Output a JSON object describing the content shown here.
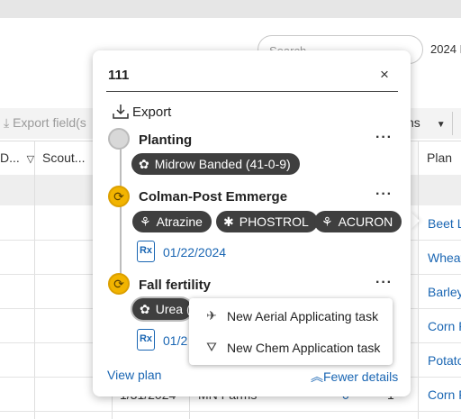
{
  "background": {
    "search_placeholder": "Search",
    "year_text": "2024 I",
    "export_fields_label": "Export field(s",
    "columns_button_label": "ns",
    "headers": {
      "date": "D...",
      "scout": "Scout...",
      "plan": "Plan"
    },
    "rows": [
      {
        "plan": "Beet L"
      },
      {
        "plan": "Wheat"
      },
      {
        "plan": "Barley"
      },
      {
        "plan": "Corn F"
      },
      {
        "plan": "Potato"
      },
      {
        "plan": "Corn F",
        "date": "1/31/2024",
        "farm": "MN Farms",
        "count": "0",
        "extra": "1"
      }
    ]
  },
  "popover": {
    "title": "111",
    "close_label": "×",
    "export_label": "Export",
    "tasks": [
      {
        "title": "Planting",
        "state": "pending",
        "menu": "···",
        "chips": [
          {
            "label": "Midrow Banded (41-0-9)",
            "icon": "seed-icon"
          }
        ]
      },
      {
        "title": "Colman-Post Emmerge",
        "state": "active",
        "menu": "···",
        "chips": [
          {
            "label": "Atrazine",
            "icon": "sprout-icon"
          },
          {
            "label": "PHOSTROL",
            "icon": "gear-icon"
          },
          {
            "label": "ACURON",
            "icon": "sprout-icon"
          }
        ],
        "rx_label": "Rx",
        "rx_date": "01/22/2024"
      },
      {
        "title": "Fall fertility",
        "state": "active",
        "menu": "···",
        "chips": [
          {
            "label": "Urea (",
            "icon": "seed-icon"
          }
        ],
        "rx_label": "Rx",
        "rx_date": "01/2"
      }
    ],
    "view_plan_label": "View plan",
    "fewer_details_label": "Fewer details"
  },
  "context_menu": {
    "items": [
      {
        "label": "New Aerial Applicating task",
        "icon": "airplane-icon"
      },
      {
        "label": "New Chem Application task",
        "icon": "sprayer-icon"
      }
    ]
  },
  "colors": {
    "link": "#1a66b3",
    "active_node": "#f2b400",
    "chip": "#3f3f3f"
  }
}
